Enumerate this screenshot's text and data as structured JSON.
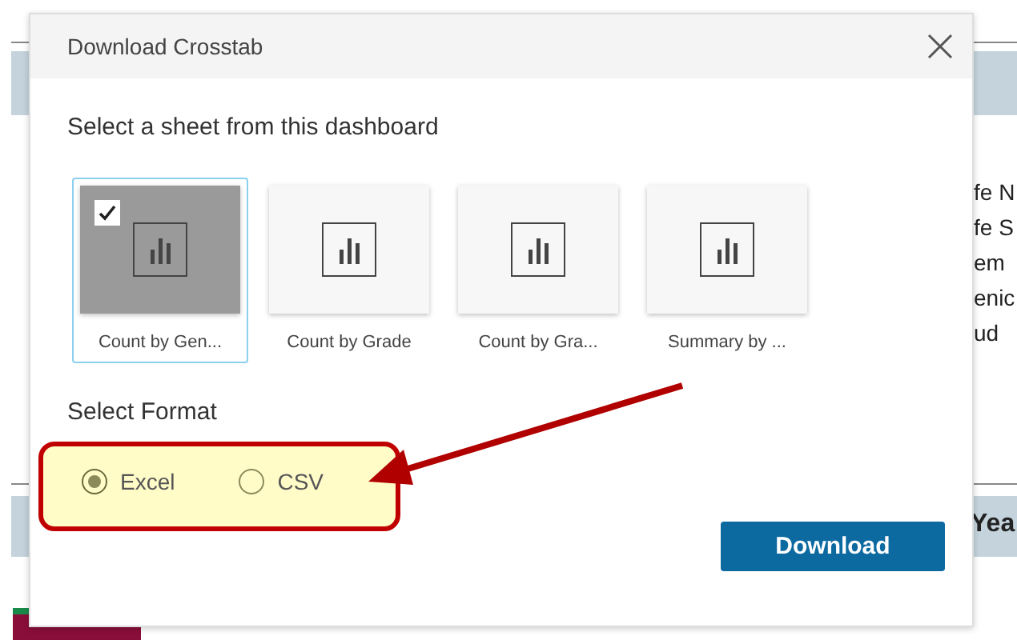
{
  "background": {
    "side_texts": [
      "fe N",
      "fe S",
      "em",
      "enic",
      "ud"
    ],
    "column_header": "Yea"
  },
  "dialog": {
    "title": "Download Crosstab",
    "sheet_prompt": "Select a sheet from this dashboard",
    "sheets": [
      {
        "label": "Count by Gen...",
        "selected": true
      },
      {
        "label": "Count by Grade",
        "selected": false
      },
      {
        "label": "Count by Gra...",
        "selected": false
      },
      {
        "label": "Summary by ...",
        "selected": false
      }
    ],
    "format_prompt": "Select Format",
    "formats": [
      {
        "label": "Excel",
        "selected": true
      },
      {
        "label": "CSV",
        "selected": false
      }
    ],
    "download_button": "Download"
  }
}
